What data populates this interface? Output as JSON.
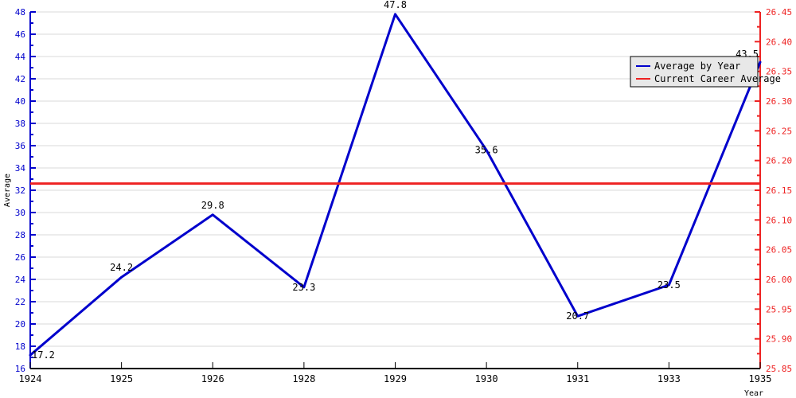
{
  "chart_data": {
    "type": "line",
    "title": "",
    "xlabel": "Year",
    "ylabel": "Average",
    "y2label": "",
    "grid": true,
    "legend_position": "top-right",
    "x": [
      1924,
      1925,
      1926,
      1928,
      1929,
      1930,
      1931,
      1933,
      1935
    ],
    "categories": [
      "1924",
      "1925",
      "1926",
      "1928",
      "1929",
      "1930",
      "1931",
      "1933",
      "1935"
    ],
    "xtick_labels": [
      "1924",
      "1925",
      "1926",
      "1928",
      "1929",
      "1930",
      "1931",
      "1933",
      "1935"
    ],
    "ylim": [
      16,
      48
    ],
    "ytick_labels": [
      "16",
      "18",
      "20",
      "22",
      "24",
      "26",
      "28",
      "30",
      "32",
      "34",
      "36",
      "38",
      "40",
      "42",
      "44",
      "46",
      "48"
    ],
    "ytick_values": [
      16,
      18,
      20,
      22,
      24,
      26,
      28,
      30,
      32,
      34,
      36,
      38,
      40,
      42,
      44,
      46,
      48
    ],
    "y2lim": [
      25.85,
      26.45
    ],
    "y2tick_labels": [
      "25.85",
      "25.90",
      "25.95",
      "26.00",
      "26.05",
      "26.10",
      "26.15",
      "26.20",
      "26.25",
      "26.30",
      "26.35",
      "26.40",
      "26.45"
    ],
    "y2tick_values": [
      25.85,
      25.9,
      25.95,
      26.0,
      26.05,
      26.1,
      26.15,
      26.2,
      26.25,
      26.3,
      26.35,
      26.4,
      26.45
    ],
    "series": [
      {
        "name": "Average by Year",
        "color": "#0000cc",
        "axis": "left",
        "values": [
          17.2,
          24.2,
          29.8,
          23.3,
          47.8,
          35.6,
          20.7,
          23.5,
          43.5
        ],
        "point_labels": [
          "17.2",
          "24.2",
          "29.8",
          "23.3",
          "47.8",
          "35.6",
          "20.7",
          "23.5",
          "43.5"
        ]
      },
      {
        "name": "Current Career Average",
        "color": "#ee2222",
        "axis": "left",
        "type": "hline",
        "value": 32.6,
        "values": [
          32.6,
          32.6,
          32.6,
          32.6,
          32.6,
          32.6,
          32.6,
          32.6,
          32.6
        ]
      }
    ],
    "legend": [
      {
        "label": "Average by Year",
        "color": "#0000cc"
      },
      {
        "label": "Current Career Average",
        "color": "#ee2222"
      }
    ],
    "colors": {
      "left_axis": "#0000cc",
      "right_axis": "#ee2222",
      "series_line": "#0000cc",
      "career_line": "#ee2222",
      "grid": "#d8d8d8",
      "background": "#ffffff",
      "legend_background": "#e8e8e8",
      "text": "#000000"
    }
  }
}
